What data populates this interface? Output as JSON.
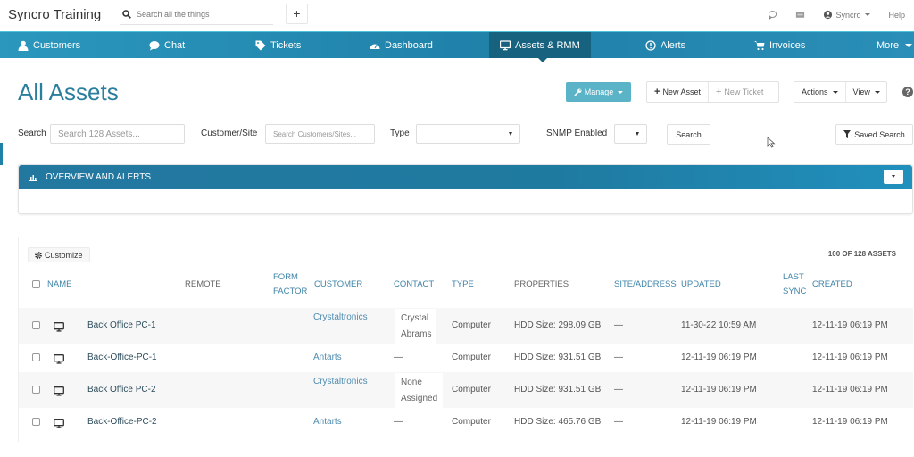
{
  "topbar": {
    "brand": "Syncro Training",
    "search_placeholder": "Search all the things",
    "add_label": "+",
    "user": "Syncro",
    "help": "Help"
  },
  "nav": {
    "items": [
      {
        "label": "Customers",
        "icon": "user-icon"
      },
      {
        "label": "Chat",
        "icon": "chat-icon"
      },
      {
        "label": "Tickets",
        "icon": "tag-icon"
      },
      {
        "label": "Dashboard",
        "icon": "dashboard-icon"
      },
      {
        "label": "Assets & RMM",
        "icon": "monitor-icon",
        "active": true
      },
      {
        "label": "Alerts",
        "icon": "alert-icon"
      },
      {
        "label": "Invoices",
        "icon": "cart-icon"
      },
      {
        "label": "More",
        "icon": "caret-down-icon"
      }
    ]
  },
  "page": {
    "title": "All Assets",
    "manage": "Manage",
    "new_asset": "New Asset",
    "new_ticket": "New Ticket",
    "actions": "Actions",
    "view": "View",
    "help_glyph": "?"
  },
  "filters": {
    "search_label": "Search",
    "search_placeholder": "Search 128 Assets...",
    "customer_label": "Customer/Site",
    "customer_placeholder": "Search Customers/Sites...",
    "type_label": "Type",
    "type_value": "",
    "snmp_label": "SNMP Enabled",
    "snmp_value": "",
    "search_button": "Search",
    "saved_search": "Saved Search"
  },
  "overview": {
    "title": "OVERVIEW AND ALERTS"
  },
  "table": {
    "customize": "Customize",
    "count": "100 OF 128 ASSETS",
    "headers": {
      "name": "NAME",
      "remote": "REMOTE",
      "form_factor_1": "FORM",
      "form_factor_2": "FACTOR",
      "customer": "CUSTOMER",
      "contact": "CONTACT",
      "type": "TYPE",
      "properties": "PROPERTIES",
      "site": "SITE/ADDRESS",
      "updated": "UPDATED",
      "last_sync_1": "LAST",
      "last_sync_2": "SYNC",
      "created": "CREATED"
    },
    "rows": [
      {
        "name": "Back Office PC-1",
        "customer": "Crystaltronics",
        "contact_1": "Crystal",
        "contact_2": "Abrams",
        "type": "Computer",
        "properties": "HDD Size: 298.09 GB",
        "site": "—",
        "updated": "11-30-22 10:59 AM",
        "created": "12-11-19 06:19 PM"
      },
      {
        "name": "Back-Office-PC-1",
        "customer": "Antarts",
        "contact_1": "—",
        "contact_2": "",
        "type": "Computer",
        "properties": "HDD Size: 931.51 GB",
        "site": "—",
        "updated": "12-11-19 06:19 PM",
        "created": "12-11-19 06:19 PM"
      },
      {
        "name": "Back Office PC-2",
        "customer": "Crystaltronics",
        "contact_1": "None",
        "contact_2": "Assigned",
        "type": "Computer",
        "properties": "HDD Size: 931.51 GB",
        "site": "—",
        "updated": "12-11-19 06:19 PM",
        "created": "12-11-19 06:19 PM"
      },
      {
        "name": "Back-Office-PC-2",
        "customer": "Antarts",
        "contact_1": "—",
        "contact_2": "",
        "type": "Computer",
        "properties": "HDD Size: 465.76 GB",
        "site": "—",
        "updated": "12-11-19 06:19 PM",
        "created": "12-11-19 06:19 PM"
      }
    ]
  }
}
